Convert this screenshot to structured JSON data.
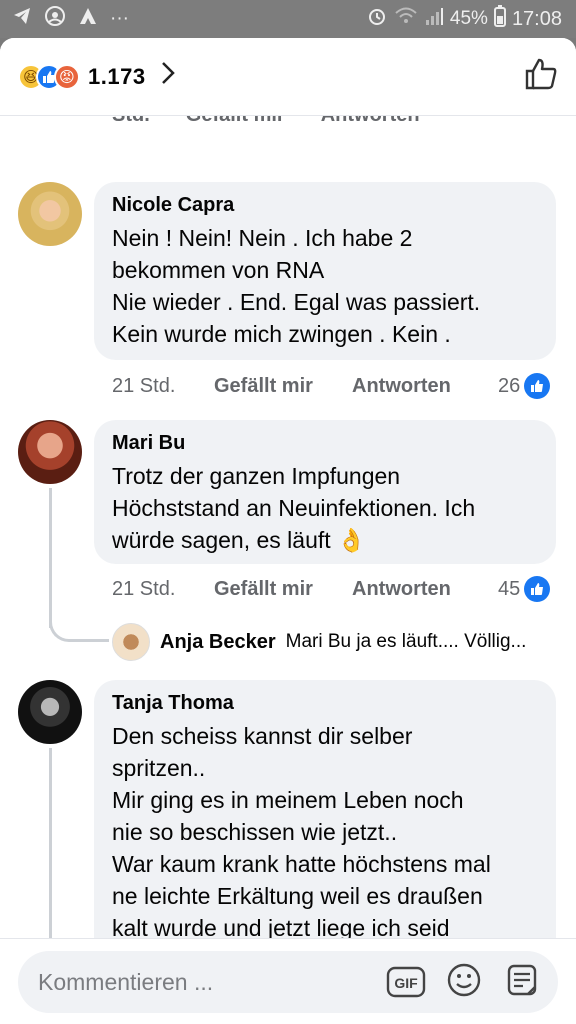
{
  "status_bar": {
    "left_icons": [
      "telegram-icon",
      "camera-icon",
      "app-icon",
      "more-icon"
    ],
    "battery": "45%",
    "time": "17:08"
  },
  "reactions": {
    "icons": [
      "haha",
      "like",
      "angry"
    ],
    "count": "1.173",
    "accent": "#1877f2"
  },
  "cut_row": {
    "time": "Std.",
    "like": "Gefällt mir",
    "reply": "Antworten"
  },
  "comments": [
    {
      "author": "Nicole Capra",
      "text": "Nein ! Nein! Nein . Ich habe 2\nbekommen von RNA\n Nie wieder . End.  Egal was passiert.\nKein wurde mich zwingen . Kein .",
      "time": "21 Std.",
      "like_label": "Gefällt mir",
      "reply_label": "Antworten",
      "reactions": "26"
    },
    {
      "author": "Mari Bu",
      "text": "Trotz der ganzen Impfungen\nHöchststand an Neuinfektionen. Ich\nwürde sagen, es läuft 👌",
      "time": "21 Std.",
      "like_label": "Gefällt mir",
      "reply_label": "Antworten",
      "reactions": "45",
      "reply_preview": {
        "author": "Anja Becker",
        "text": "Mari Bu ja es läuft.... Völlig..."
      }
    },
    {
      "author": "Tanja Thoma",
      "text": "Den scheiss kannst dir selber\nspritzen..\nMir ging es in meinem Leben noch\nnie so beschissen wie jetzt..\nWar kaum krank hatte höchstens mal\nne leichte Erkältung weil es draußen\nkalt wurde und jetzt liege ich seid\nlängerem flach.."
    }
  ],
  "composer": {
    "placeholder": "Kommentieren ...",
    "gif_label": "GIF"
  }
}
